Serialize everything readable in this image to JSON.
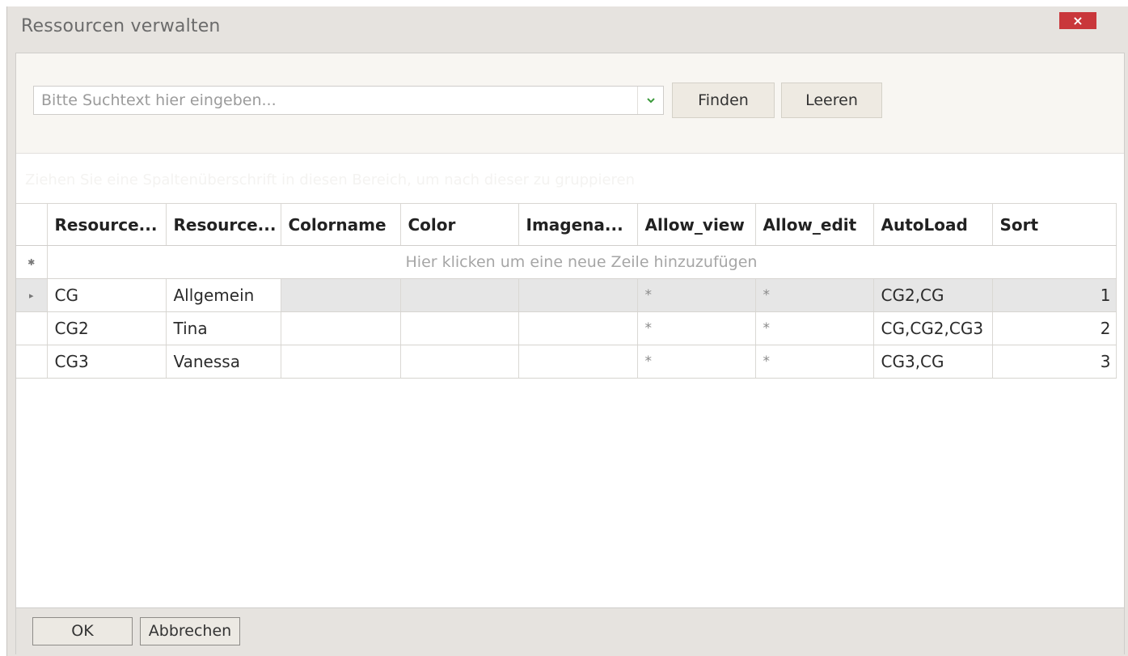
{
  "window": {
    "title": "Ressourcen verwalten",
    "close_label": "×"
  },
  "search": {
    "placeholder": "Bitte Suchtext hier eingeben...",
    "find_label": "Finden",
    "clear_label": "Leeren"
  },
  "group_panel": {
    "hint": "Ziehen Sie eine Spaltenüberschrift in diesen Bereich, um nach dieser zu gruppieren"
  },
  "grid": {
    "columns": [
      "Resource...",
      "Resource...",
      "Colorname",
      "Color",
      "Imagena...",
      "Allow_view",
      "Allow_edit",
      "AutoLoad",
      "Sort"
    ],
    "new_row_marker": "✱",
    "new_row_text": "Hier klicken um eine neue Zeile hinzuzufügen",
    "rows": [
      {
        "c0": "CG",
        "c1": "Allgemein",
        "c2": "",
        "c3": "",
        "c4": "",
        "c5": "*",
        "c6": "*",
        "c7": "CG2,CG",
        "c8": "1"
      },
      {
        "c0": "CG2",
        "c1": "Tina",
        "c2": "",
        "c3": "",
        "c4": "",
        "c5": "*",
        "c6": "*",
        "c7": "CG,CG2,CG3",
        "c8": "2"
      },
      {
        "c0": "CG3",
        "c1": "Vanessa",
        "c2": "",
        "c3": "",
        "c4": "",
        "c5": "*",
        "c6": "*",
        "c7": "CG3,CG",
        "c8": "3"
      }
    ],
    "selected_row_marker": "▸"
  },
  "footer": {
    "ok_label": "OK",
    "cancel_label": "Abbrechen"
  },
  "colors": {
    "close_button": "#c9373b",
    "window_chrome": "#e6e3df",
    "selected_row": "#e6e6e6"
  }
}
